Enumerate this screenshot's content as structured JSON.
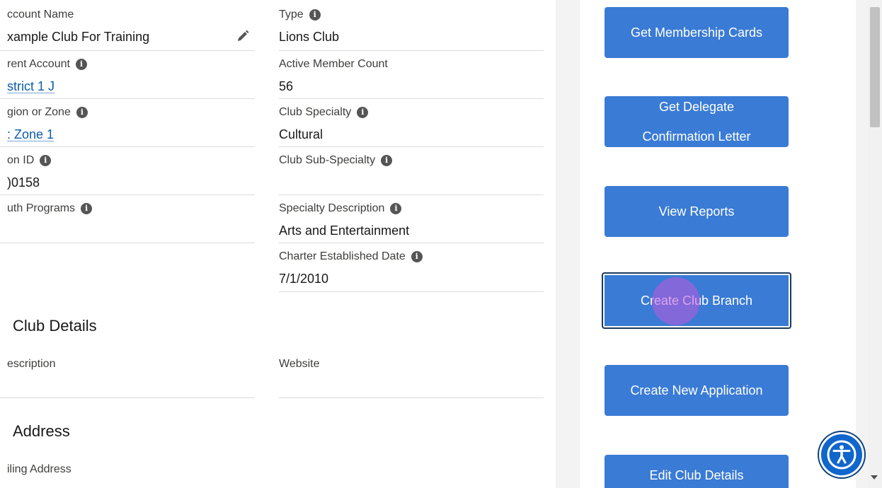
{
  "left": {
    "col1": [
      {
        "label": "ccount Name",
        "value": "xample Club For Training",
        "editable": true
      },
      {
        "label": "rent Account",
        "value": "strict 1 J",
        "info": true,
        "link": true
      },
      {
        "label": "gion or Zone",
        "value": "Zone 1",
        "info": true,
        "link": true
      },
      {
        "label": "on ID",
        "value": ")0158",
        "info": true
      },
      {
        "label": "uth Programs",
        "value": "",
        "info": true
      }
    ],
    "col2": [
      {
        "label": "Type",
        "value": "Lions Club",
        "info": true
      },
      {
        "label": "Active Member Count",
        "value": "56"
      },
      {
        "label": "Club Specialty",
        "value": "Cultural",
        "info": true
      },
      {
        "label": "Club Sub-Specialty",
        "value": "",
        "info": true
      },
      {
        "label": "Specialty Description",
        "value": "Arts and Entertainment",
        "info": true
      },
      {
        "label": "Charter Established Date",
        "value": "7/1/2010",
        "info": true
      }
    ],
    "club_details_title": "Club Details",
    "description_label": "escription",
    "website_label": "Website",
    "address_title": "Address",
    "mailing_label": "iling Address"
  },
  "buttons": {
    "membership_cards": "Get Membership Cards",
    "delegate_line1": "Get Delegate",
    "delegate_line2": "Confirmation Letter",
    "view_reports": "View Reports",
    "create_branch": "Create Club Branch",
    "create_application": "Create New Application",
    "edit_details": "Edit Club Details"
  },
  "colors": {
    "button": "#3a7bd5",
    "link": "#0b5cab",
    "accessibility": "#1166cc"
  },
  "icons": {
    "info": "info-icon",
    "edit": "pencil-icon",
    "accessibility": "accessibility-icon"
  }
}
